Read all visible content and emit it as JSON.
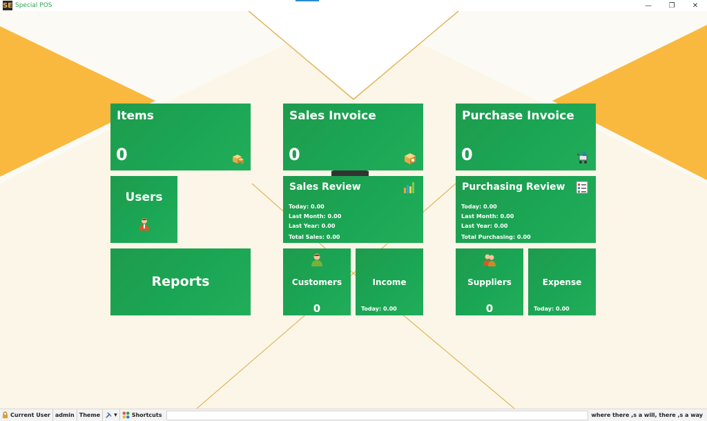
{
  "window": {
    "title": "Special POS",
    "app_icon_text": "SE",
    "minimize_glyph": "—",
    "restore_glyph": "❐",
    "close_glyph": "✕"
  },
  "tiles": {
    "items": {
      "title": "Items",
      "count": "0",
      "icon": "boxes-icon"
    },
    "sales_invoice": {
      "title": "Sales Invoice",
      "count": "0",
      "icon": "package-icon"
    },
    "purchase_invoice": {
      "title": "Purchase Invoice",
      "count": "0",
      "icon": "cart-icon"
    },
    "users": {
      "title": "Users",
      "icon": "user-icon"
    },
    "sales_review": {
      "title": "Sales Review",
      "icon": "bar-chart-icon",
      "today": "Today: 0.00",
      "last_month": "Last Month: 0.00",
      "last_year": "Last Year: 0.00",
      "total": "Total Sales: 0.00"
    },
    "purchasing_review": {
      "title": "Purchasing Review",
      "icon": "checklist-icon",
      "today": "Today: 0.00",
      "last_month": "Last Month: 0.00",
      "last_year": "Last Year: 0.00",
      "total": "Total Purchasing: 0.00"
    },
    "reports": {
      "title": "Reports"
    },
    "customers": {
      "title": "Customers",
      "count": "0",
      "icon": "customer-icon"
    },
    "income": {
      "title": "Income",
      "today": "Today: 0.00"
    },
    "suppliers": {
      "title": "Suppliers",
      "count": "0",
      "icon": "suppliers-icon"
    },
    "expense": {
      "title": "Expense",
      "today": "Today: 0.00"
    }
  },
  "statusbar": {
    "current_user_label": "Current User",
    "user_name": "admin",
    "theme_label": "Theme",
    "shortcuts_label": "Shortcuts",
    "motto": "where there ,s a will, there ,s a way"
  },
  "colors": {
    "tile_green": "#1aa654",
    "accent_orange": "#f8b93e",
    "gold_line": "#e2b55a",
    "title_green": "#2aa74e"
  }
}
